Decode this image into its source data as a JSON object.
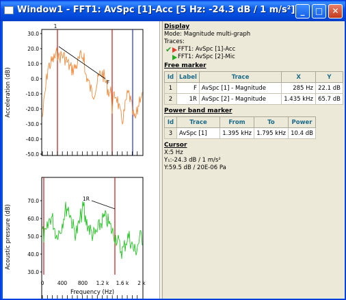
{
  "window": {
    "title": "Window1 - FFT1: AvSpc [1]-Acc [5 Hz: -24.3 dB / 1 m/s²]",
    "buttons": {
      "minimize": "_",
      "maximize": "□",
      "close": "✕"
    }
  },
  "plots": {
    "top": {
      "ylabel": "Acceleration (dB)",
      "yticks": [
        "30.0",
        "20.0",
        "10.0",
        "0.0",
        "-10.0",
        "-20.0",
        "-30.0",
        "-40.0",
        "-50.0"
      ],
      "marker_num": "1",
      "marker_label": "F",
      "color": "#f08a3c"
    },
    "bottom": {
      "ylabel": "Acoustic pressure (dB)",
      "yticks": [
        "70.0",
        "60.0",
        "50.0",
        "40.0",
        "30.0"
      ],
      "marker_label": "1R",
      "color": "#22c322"
    },
    "xticks": [
      "0",
      "400",
      "800",
      "1.2 k",
      "1.6 k",
      "2 k"
    ],
    "xlabel": "Frequency (Hz)"
  },
  "info": {
    "display": {
      "title": "Display",
      "mode": "Mode: Magnitude multi-graph",
      "traces_label": "Traces:",
      "traces": [
        "FFT1: AvSpc [1]-Acc",
        "FFT1: AvSpc [2]-Mic"
      ]
    },
    "free_marker": {
      "title": "Free marker",
      "headers": [
        "Id",
        "Label",
        "Trace",
        "X",
        "Y"
      ],
      "rows": [
        [
          "1",
          "F",
          "AvSpc [1] - Magnitude",
          "285 Hz",
          "22.1 dB"
        ],
        [
          "2",
          "1R",
          "AvSpc [2] - Magnitude",
          "1.435 kHz",
          "65.7 dB"
        ]
      ]
    },
    "power_band": {
      "title": "Power band marker",
      "headers": [
        "Id",
        "Trace",
        "From",
        "To",
        "Power"
      ],
      "rows": [
        [
          "3",
          "AvSpc [1]",
          "1.395 kHz",
          "1.795 kHz",
          "10.4 dB"
        ]
      ]
    },
    "cursor": {
      "title": "Cursor",
      "x": "X:5 Hz",
      "y1": "Y₁:-24.3 dB / 1 m/s²",
      "y2": "Y:59.5 dB / 20E-06 Pa"
    }
  }
}
